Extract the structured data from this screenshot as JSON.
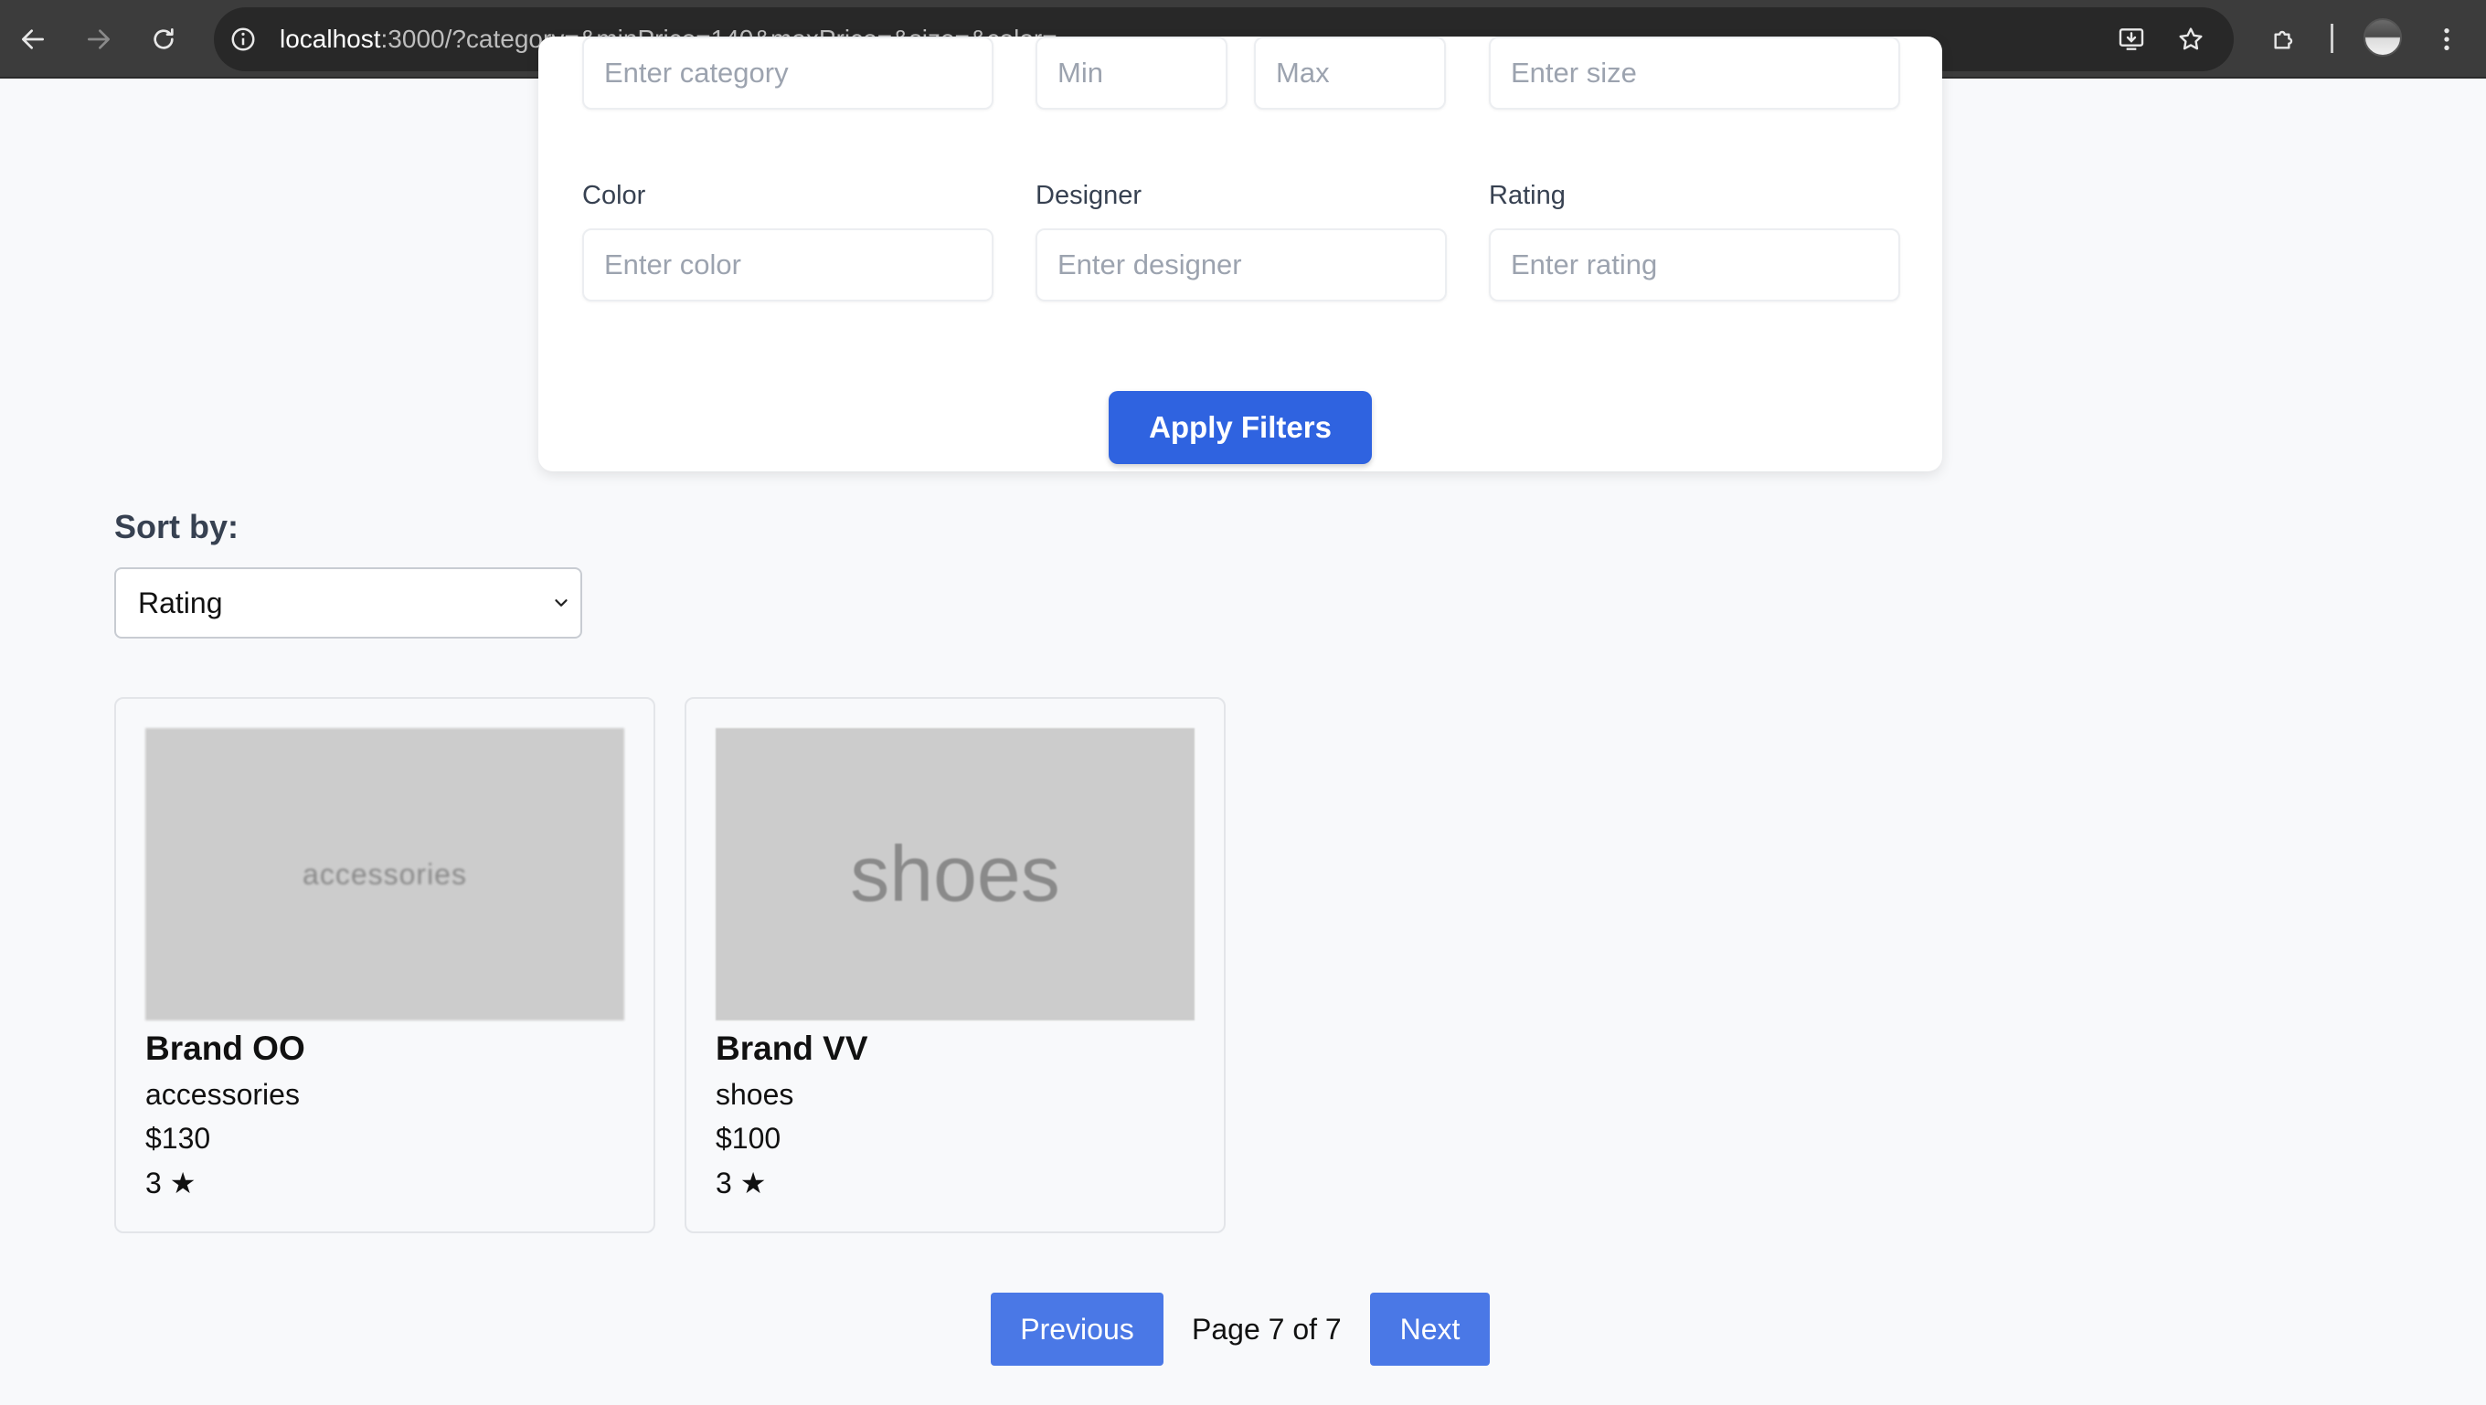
{
  "browser": {
    "url_host": "localhost",
    "url_path": ":3000/?category=&minPrice=140&maxPrice=&size=&color="
  },
  "filters": {
    "category_placeholder": "Enter category",
    "min_price_placeholder": "Min",
    "max_price_placeholder": "Max",
    "size_placeholder": "Enter size",
    "color_label": "Color",
    "color_placeholder": "Enter color",
    "designer_label": "Designer",
    "designer_placeholder": "Enter designer",
    "rating_label": "Rating",
    "rating_placeholder": "Enter rating",
    "apply_label": "Apply Filters"
  },
  "sort": {
    "label": "Sort by:",
    "selected": "Rating"
  },
  "products": [
    {
      "image_text": "accessories",
      "name": "Brand OO",
      "category": "accessories",
      "price": "$130",
      "rating": "3"
    },
    {
      "image_text": "shoes",
      "name": "Brand VV",
      "category": "shoes",
      "price": "$100",
      "rating": "3"
    }
  ],
  "pagination": {
    "previous_label": "Previous",
    "page_text": "Page 7 of 7",
    "next_label": "Next"
  },
  "colors": {
    "primary": "#2f63e0",
    "pagination": "#4a78e6",
    "placeholder_image": "#cccccc"
  }
}
